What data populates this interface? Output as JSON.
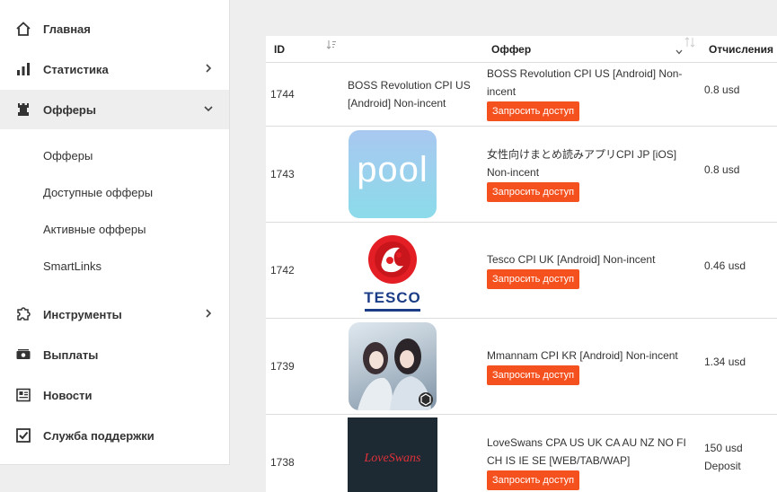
{
  "sidebar": {
    "items": [
      {
        "label": "Главная",
        "icon": "home-icon"
      },
      {
        "label": "Статистика",
        "icon": "bar-chart-icon"
      },
      {
        "label": "Офферы",
        "icon": "chess-rook-icon"
      },
      {
        "label": "Инструменты",
        "icon": "puzzle-icon"
      },
      {
        "label": "Выплаты",
        "icon": "money-icon"
      },
      {
        "label": "Новости",
        "icon": "newspaper-icon"
      },
      {
        "label": "Служба поддержки",
        "icon": "checkbox-icon"
      }
    ],
    "sub_items": [
      "Офферы",
      "Доступные офферы",
      "Активные офферы",
      "SmartLinks"
    ]
  },
  "table": {
    "headers": {
      "id": "ID",
      "offer": "Оффер",
      "payout": "Отчисления"
    },
    "rows": [
      {
        "id": "1744",
        "thumb_text": "BOSS Revolution CPI US [Android] Non-incent",
        "offer_name": "BOSS Revolution CPI US [Android] Non-incent",
        "button": "Запросить доступ",
        "payout": "0.8 usd"
      },
      {
        "id": "1743",
        "thumb_text": "pool",
        "offer_name": "女性向けまとめ読みアプリCPI JP [iOS] Non-incent",
        "button": "Запросить доступ",
        "payout": "0.8 usd"
      },
      {
        "id": "1742",
        "thumb_text": "TESCO",
        "offer_name": "Tesco CPI UK [Android] Non-incent",
        "button": "Запросить доступ",
        "payout": "0.46 usd"
      },
      {
        "id": "1739",
        "thumb_text": "",
        "offer_name": "Mmannam CPI KR [Android] Non-incent",
        "button": "Запросить доступ",
        "payout": "1.34 usd"
      },
      {
        "id": "1738",
        "thumb_text": "LoveSwans",
        "offer_name": "LoveSwans CPA US UK CA AU NZ NO FI CH IS IE SE [WEB/TAB/WAP]",
        "button": "Запросить доступ",
        "payout": "150 usd Deposit"
      }
    ]
  },
  "colors": {
    "accent": "#f4511e",
    "active_bg": "#eeeeee",
    "pool_bg": "#8ed6ef",
    "tesco_red": "#e31e24",
    "loveswans_bg": "#1e2a33"
  }
}
